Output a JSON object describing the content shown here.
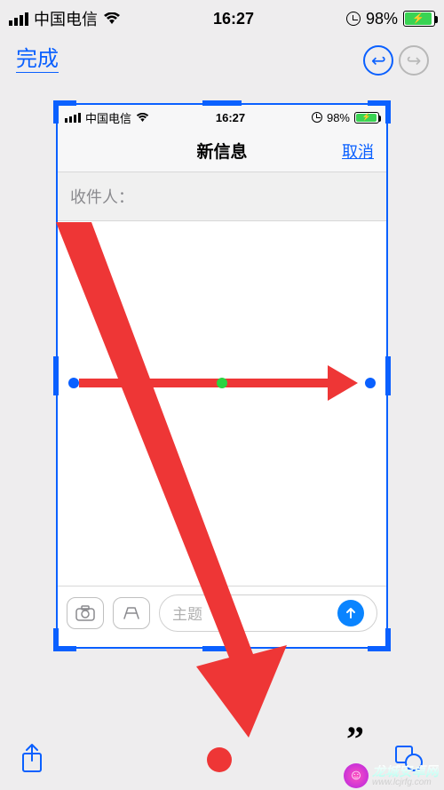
{
  "outer_status": {
    "carrier": "中国电信",
    "time": "16:27",
    "battery": "98%"
  },
  "editor": {
    "done": "完成"
  },
  "inner_status": {
    "carrier": "中国电信",
    "time": "16:27",
    "battery": "98%"
  },
  "compose": {
    "title": "新信息",
    "cancel": "取消",
    "to_label": "收件人：",
    "subject_placeholder": "主题"
  },
  "watermark": {
    "line1": "龙城安卓网",
    "line2": "www.lcjrfg.com"
  }
}
